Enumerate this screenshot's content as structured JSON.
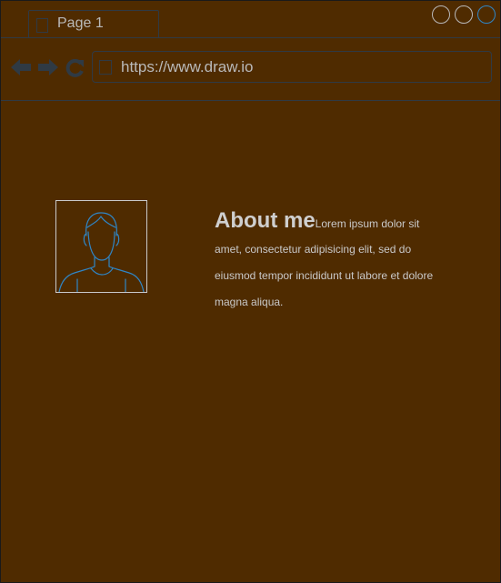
{
  "browser": {
    "tab_label": "Page 1",
    "url": "https://www.draw.io",
    "icons": {
      "back": "arrow-left-icon",
      "forward": "arrow-right-icon",
      "refresh": "refresh-icon",
      "page": "page-icon"
    },
    "colors": {
      "background": "#4f2b00",
      "chrome_lines": "#2f3a44",
      "text": "#b9b9b9",
      "accent": "#2f86c6"
    }
  },
  "profile": {
    "avatar_icon": "user-avatar-icon",
    "heading": "About me",
    "body_lines": [
      "Lorem ipsum dolor sit",
      "amet, consectetur adipisicing elit, sed do",
      "eiusmod tempor incididunt ut labore et dolore",
      "magna aliqua."
    ]
  }
}
